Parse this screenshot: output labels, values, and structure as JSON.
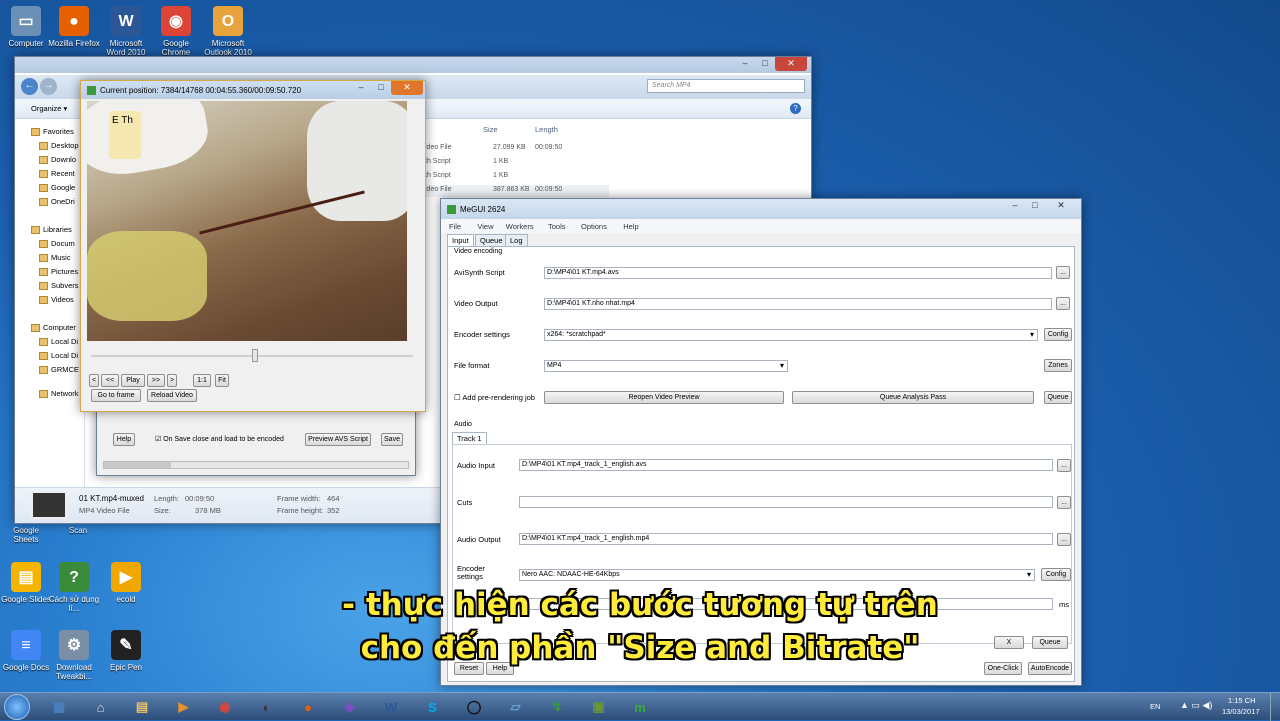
{
  "desktop": {
    "icons": [
      {
        "name": "computer-icon",
        "label": "Computer",
        "glyph": "▭",
        "color": "#6c8fb5"
      },
      {
        "name": "firefox-icon",
        "label": "Mozilla Firefox",
        "glyph": "●",
        "color": "#e66000"
      },
      {
        "name": "word-icon",
        "label": "Microsoft Word 2010",
        "glyph": "W",
        "color": "#2b5797"
      },
      {
        "name": "chrome-icon",
        "label": "Google Chrome",
        "glyph": "◉",
        "color": "#db4437"
      },
      {
        "name": "outlook-icon",
        "label": "Microsoft Outlook 2010",
        "glyph": "O",
        "color": "#e8a33c"
      },
      {
        "name": "google-slides-icon",
        "label": "Google Slides",
        "glyph": "▤",
        "color": "#f4b400"
      },
      {
        "name": "cach-su-dung-icon",
        "label": "Cách sử dụng lí...",
        "glyph": "?",
        "color": "#3a8a3a"
      },
      {
        "name": "ecold-icon",
        "label": "ecold",
        "glyph": "▶",
        "color": "#f0a800"
      },
      {
        "name": "google-docs-icon",
        "label": "Google Docs",
        "glyph": "≡",
        "color": "#4285f4"
      },
      {
        "name": "download-tweakbit-icon",
        "label": "Download Tweakbi...",
        "glyph": "⚙",
        "color": "#7a8ea6"
      },
      {
        "name": "epic-pen-icon",
        "label": "Epic Pen",
        "glyph": "✎",
        "color": "#222"
      },
      {
        "name": "google-sheets-icon",
        "label": "Google Sheets",
        "glyph": "",
        "color": ""
      },
      {
        "name": "scan-icon",
        "label": "Scan",
        "glyph": "",
        "color": ""
      }
    ]
  },
  "explorer": {
    "search_placeholder": "Search MP4",
    "toolbar": {
      "organize": "Organize ▾"
    },
    "nav": [
      {
        "label": "Favorites",
        "glyph": "★"
      },
      {
        "label": "Desktop"
      },
      {
        "label": "Downlo"
      },
      {
        "label": "Recent"
      },
      {
        "label": "Google"
      },
      {
        "label": "OneDri"
      },
      {
        "label": "Libraries"
      },
      {
        "label": "Docum"
      },
      {
        "label": "Music"
      },
      {
        "label": "Pictures"
      },
      {
        "label": "Subvers"
      },
      {
        "label": "Videos"
      },
      {
        "label": "Computer"
      },
      {
        "label": "Local Di"
      },
      {
        "label": "Local Di"
      },
      {
        "label": "GRMCE"
      },
      {
        "label": "Network"
      }
    ],
    "columns": {
      "size": "Size",
      "length": "Length"
    },
    "rows": [
      {
        "type": "ideo File",
        "size": "27.099 KB",
        "length": "00:09:50"
      },
      {
        "type": "th Script",
        "size": "1 KB",
        "length": ""
      },
      {
        "type": "th Script",
        "size": "1 KB",
        "length": ""
      },
      {
        "type": "ideo File",
        "size": "387.863 KB",
        "length": "00:09:50"
      }
    ],
    "details": {
      "name": "01 KT.mp4-muxed",
      "type": "MP4 Video File",
      "length_label": "Length:",
      "length": "00:09:50",
      "size_label": "Size:",
      "size": "378 MB",
      "fw_label": "Frame width:",
      "fw": "464",
      "fh_label": "Frame height:",
      "fh": "352"
    }
  },
  "preview": {
    "title": "Current position: 7384/14768    00:04:55.360/00:09:50.720",
    "buttons": [
      "<",
      "<<",
      "Play",
      ">>",
      ">",
      "1:1",
      "Fit"
    ],
    "goto": "Go to frame",
    "reload": "Reload Video",
    "video_text": "E Th"
  },
  "avs": {
    "help": "Help",
    "checkbox": "On Save close and load to be encoded",
    "preview": "Preview AVS Script",
    "save": "Save"
  },
  "megui": {
    "title": "MeGUI 2624",
    "menu": [
      "File",
      "View",
      "Workers",
      "Tools",
      "Options",
      "Help"
    ],
    "tabs": [
      "Input",
      "Queue",
      "Log"
    ],
    "video_section": "Video encoding",
    "avisynth_label": "AviSynth Script",
    "avisynth_value": "D:\\MP4\\01 KT.mp4.avs",
    "video_output_label": "Video Output",
    "video_output_value": "D:\\MP4\\01 KT.nho nhat.mp4",
    "encoder_label": "Encoder settings",
    "encoder_value": "x264: *scratchpad*",
    "config": "Config",
    "file_format_label": "File format",
    "file_format_value": "MP4",
    "zones": "Zones",
    "prerender_label": "Add pre-rendering job",
    "reopen": "Reopen Video Preview",
    "analysis": "Queue Analysis Pass",
    "queue": "Queue",
    "audio_section": "Audio",
    "track_tab": "Track 1",
    "audio_input_label": "Audio Input",
    "audio_input_value": "D:\\MP4\\01 KT.mp4_track_1_english.avs",
    "cuts_label": "Cuts",
    "audio_output_label": "Audio Output",
    "audio_output_value": "D:\\MP4\\01 KT.mp4_track_1_english.mp4",
    "audio_encoder_label": "Encoder settings",
    "audio_encoder_value": "Nero AAC: NDAAC-HE-64Kbps",
    "audio_config": "Config",
    "delay_unit": "ms",
    "dots": "...",
    "x_btn": "X",
    "queue2": "Queue",
    "reset": "Reset",
    "help": "Help",
    "oneclick": "One-Click",
    "autoencode": "AutoEncode"
  },
  "subtitle": {
    "line1": "- thực hiện các bước tương tự trên",
    "line2": "cho đến phần \"Size and Bitrate\""
  },
  "taskbar": {
    "lang": "EN",
    "time": "1:15 CH",
    "date": "13/03/2017",
    "apps": [
      {
        "g": "▦",
        "c": "#4a7fc0"
      },
      {
        "g": "⌂",
        "c": "#ddd"
      },
      {
        "g": "▤",
        "c": "#e8c26a"
      },
      {
        "g": "▶",
        "c": "#e89030"
      },
      {
        "g": "◉",
        "c": "#db4437"
      },
      {
        "g": "◐",
        "c": "#333"
      },
      {
        "g": "●",
        "c": "#e66000"
      },
      {
        "g": "◆",
        "c": "#7b4fc0"
      },
      {
        "g": "W",
        "c": "#2b5797"
      },
      {
        "g": "S",
        "c": "#00aff0"
      },
      {
        "g": "◯",
        "c": "#111"
      },
      {
        "g": "▱",
        "c": "#6aa0d0"
      },
      {
        "g": "↯",
        "c": "#3a9a3a"
      },
      {
        "g": "▣",
        "c": "#6a9a2a"
      },
      {
        "g": "m",
        "c": "#3aaa3a"
      }
    ]
  },
  "colors": {
    "taskbar": "#2c4d7a",
    "subtitle": "#ffeb3b",
    "close": "#c9463d"
  }
}
